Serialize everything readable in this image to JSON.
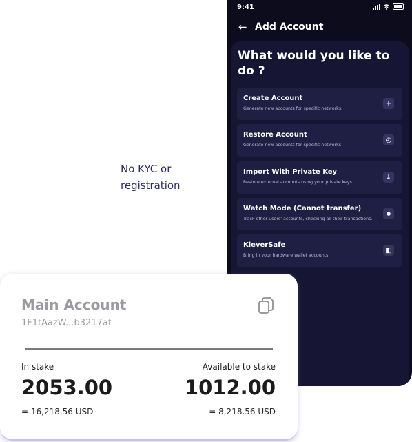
{
  "tagline": {
    "line1": "No KYC or",
    "line2": "registration"
  },
  "phone": {
    "status_time": "9:41",
    "header": {
      "title": "Add Account"
    },
    "question": "What would you like to do ?",
    "options": [
      {
        "title": "Create Account",
        "description": "Generate new accounts for specific networks.",
        "icon": "plus-icon",
        "glyph": "+"
      },
      {
        "title": "Restore Account",
        "description": "Generate new accounts for specific networks",
        "icon": "clock-icon",
        "glyph": "◴"
      },
      {
        "title": "Import With Private Key",
        "description": "Restore external accounts using your private keys.",
        "icon": "download-icon",
        "glyph": "↓"
      },
      {
        "title": "Watch Mode (Cannot transfer)",
        "description": "Track other users' accounts, checking all their transactions.",
        "icon": "eye-icon",
        "glyph": "●"
      },
      {
        "title": "KleverSafe",
        "description": "Bring in your hardware wallet accounts",
        "icon": "hardware-wallet-icon",
        "glyph": "◧"
      }
    ]
  },
  "account_card": {
    "title": "Main Account",
    "address": "1F1tAazW...b3217af",
    "copy_icon": "copy-icon",
    "left": {
      "label": "In stake",
      "value": "2053.00",
      "usd": "= 16,218.56 USD"
    },
    "right": {
      "label": "Available to stake",
      "value": "1012.00",
      "usd": "= 8,218.56 USD"
    }
  },
  "colors": {
    "phone_bg": "#0c0c1d",
    "sheet_bg": "#161634",
    "option_bg": "#1f1f44",
    "tagline": "#2c2a6b",
    "card_text": "#1b1b1b",
    "card_muted": "#9a9aa0"
  }
}
